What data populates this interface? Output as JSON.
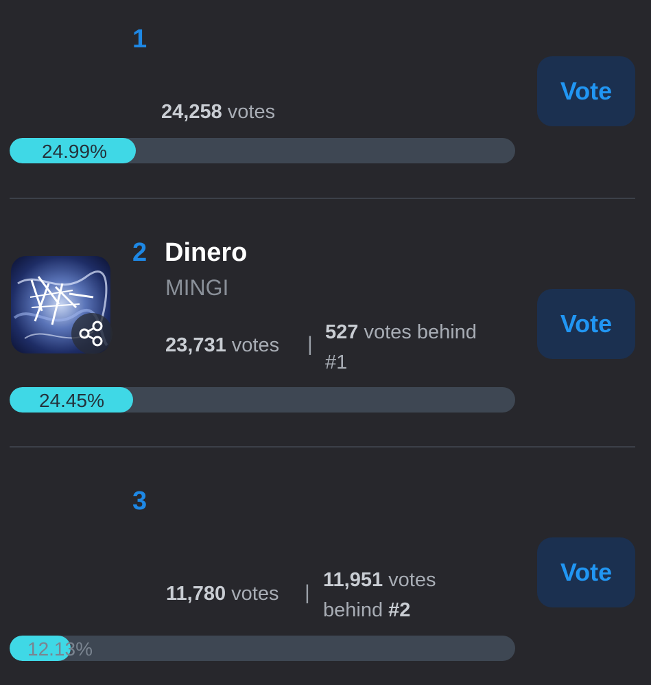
{
  "entries": [
    {
      "rank": "1",
      "title": "",
      "artist": "",
      "votes_count": "24,258",
      "votes_word": "votes",
      "behind_count": "",
      "behind_text": "",
      "percent_label": "24.99%",
      "percent": 24.99,
      "vote_label": "Vote"
    },
    {
      "rank": "2",
      "title": "Dinero",
      "artist": "MINGI",
      "votes_count": "23,731",
      "votes_word": "votes",
      "separator": "|",
      "behind_count": "527",
      "behind_text": "votes behind",
      "behind_target": "#1",
      "percent_label": "24.45%",
      "percent": 24.45,
      "vote_label": "Vote",
      "thumbnail_icon": "album-art-image",
      "share_icon": "share-icon"
    },
    {
      "rank": "3",
      "title": "",
      "artist": "",
      "votes_count": "11,780",
      "votes_word": "votes",
      "separator": "|",
      "behind_count": "11,951",
      "behind_text": "votes",
      "behind_prefix": "behind",
      "behind_target": "#2",
      "percent_label": "12.13%",
      "percent": 12.13,
      "vote_label": "Vote"
    }
  ],
  "colors": {
    "background": "#27272c",
    "rank": "#1e88e5",
    "bar_fill": "#3fd8e6",
    "bar_track": "#3e4753",
    "vote_button_bg": "#1b3050",
    "vote_button_text": "#2196f3"
  }
}
